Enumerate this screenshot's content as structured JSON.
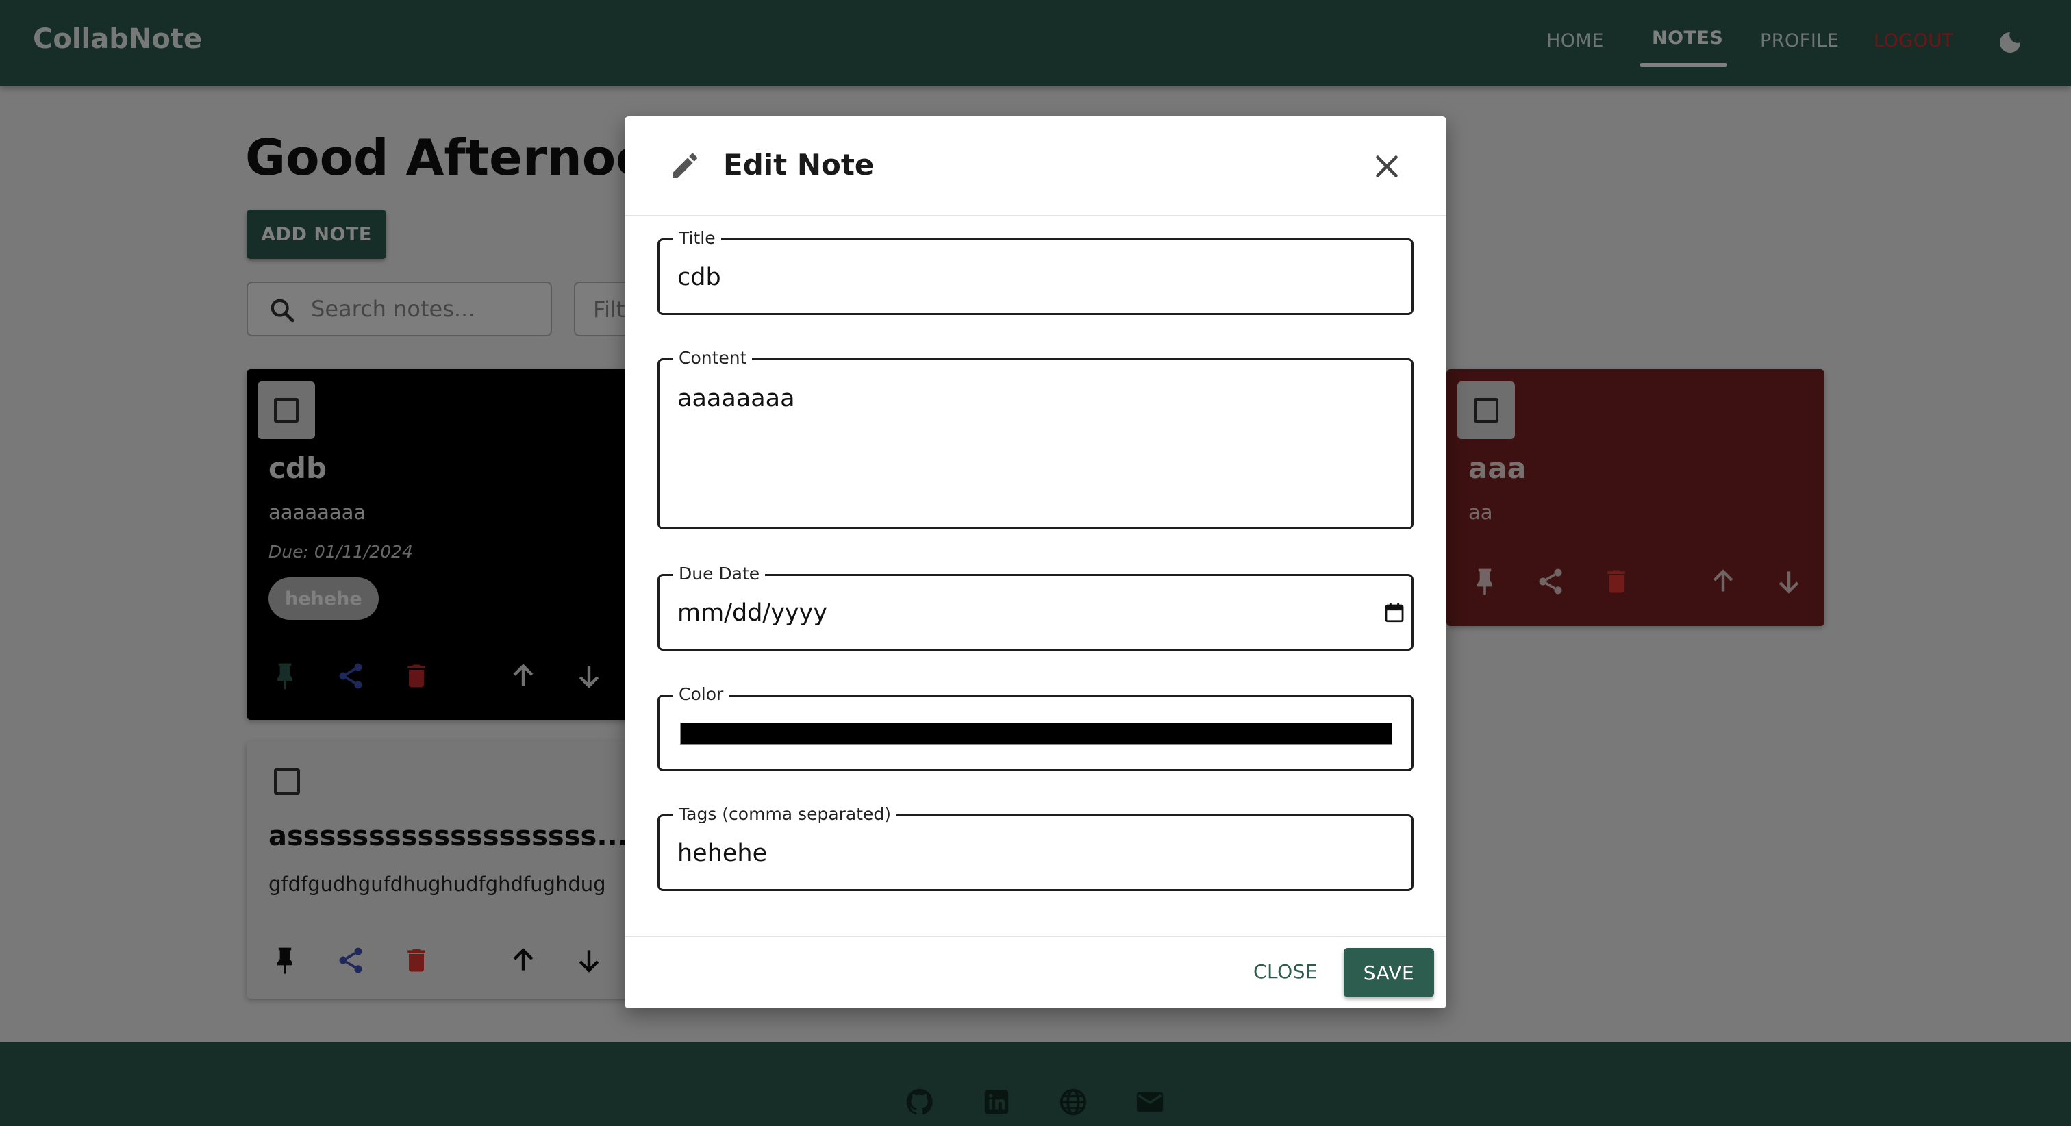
{
  "navbar": {
    "brand": "CollabNote",
    "links": {
      "home": "HOME",
      "notes": "NOTES",
      "profile": "PROFILE",
      "logout": "LOGOUT"
    },
    "theme_toggle_icon": "moon-icon"
  },
  "main": {
    "greeting": "Good Afternoon,",
    "add_note_label": "ADD NOTE",
    "search": {
      "placeholder": "Search notes..."
    },
    "filter": {
      "label": "Filt"
    }
  },
  "notes": [
    {
      "title": "cdb",
      "content": "aaaaaaaa",
      "due": "Due: 01/11/2024",
      "tags": [
        "hehehe"
      ],
      "color": "#000000"
    },
    {
      "title": "asssssssssssssssssss...",
      "content": "gfdfgudhgufdhughudfghdfughdug",
      "color": "#ececec"
    },
    {
      "title": "aaa",
      "content": "aa",
      "color": "#7a2222"
    }
  ],
  "modal": {
    "title": "Edit Note",
    "fields": {
      "title": {
        "label": "Title",
        "value": "cdb"
      },
      "content": {
        "label": "Content",
        "value": "aaaaaaaa"
      },
      "due_date": {
        "label": "Due Date",
        "value": "mm/dd/yyyy"
      },
      "color": {
        "label": "Color",
        "value": "#000000"
      },
      "tags": {
        "label": "Tags (comma separated)",
        "value": "hehehe"
      }
    },
    "close_label": "CLOSE",
    "save_label": "SAVE"
  },
  "footer": {
    "icons": [
      "github-icon",
      "linkedin-icon",
      "globe-icon",
      "mail-icon"
    ]
  },
  "colors": {
    "primary": "#2d5d4e",
    "logout": "#d32f2f",
    "delete": "#e53935",
    "share": "#3f51b5",
    "pin_active": "#2d5d4e"
  }
}
